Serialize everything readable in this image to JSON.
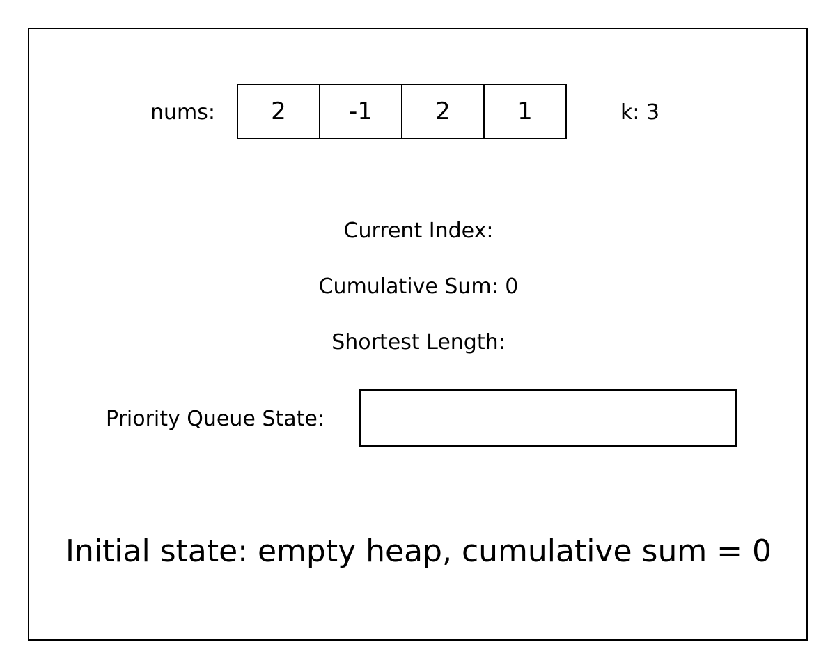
{
  "nums": {
    "label": "nums:",
    "values": [
      "2",
      "-1",
      "2",
      "1"
    ]
  },
  "k": {
    "label": "k: 3"
  },
  "status": {
    "current_index": "Current Index:",
    "cumulative_sum": "Cumulative Sum: 0",
    "shortest_length": "Shortest Length:"
  },
  "priority_queue": {
    "label": "Priority Queue State:",
    "items": []
  },
  "caption": "Initial state: empty heap, cumulative sum = 0"
}
